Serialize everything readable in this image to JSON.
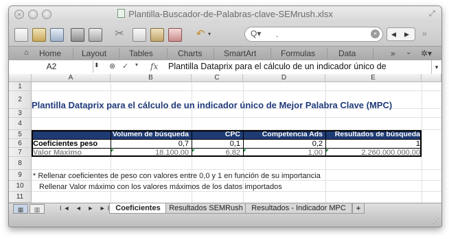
{
  "window": {
    "title": "Plantilla-Buscador-de-Palabras-clave-SEMrush.xlsx"
  },
  "toolbar": {
    "icons": [
      "new-icon",
      "templates-icon",
      "open-icon",
      "save-icon",
      "print-icon",
      "cut-icon",
      "copy-icon",
      "paste-icon",
      "format-painter-icon",
      "undo-icon"
    ],
    "search_text": "."
  },
  "ribbon": {
    "tabs": [
      "Home",
      "Layout",
      "Tables",
      "Charts",
      "SmartArt",
      "Formulas",
      "Data"
    ],
    "more": "»"
  },
  "formula_bar": {
    "cell_ref": "A2",
    "fx": "fx",
    "content": "Plantilla Dataprix para el cálculo de un indicador único de"
  },
  "grid": {
    "columns": [
      "A",
      "B",
      "C",
      "D",
      "E"
    ],
    "rows": [
      "1",
      "2",
      "3",
      "4",
      "5",
      "6",
      "7",
      "8",
      "9",
      "10",
      "11"
    ],
    "title": "Plantilla Dataprix para el cálculo de un indicador único de Mejor Palabra Clave (MPC)",
    "table": {
      "headers": [
        "Volumen de búsqueda",
        "CPC",
        "Competencia Ads",
        "Resultados de búsqueda"
      ],
      "rows": [
        {
          "label": "Coeficientes peso",
          "values": [
            "0,7",
            "0,1",
            "0,2",
            "1"
          ]
        },
        {
          "label": "Valor Maximo",
          "values": [
            "18.100,00",
            "6,82",
            "1,00",
            "2.260.000.000,00"
          ]
        }
      ]
    },
    "notes": [
      "* Rellenar coeficientes de peso con valores entre 0,0 y 1 en función de su importancia",
      "Rellenar Valor máximo con los valores máximos de los datos importados"
    ]
  },
  "sheets": {
    "nav": "I◄ ◄ ► ►I",
    "tabs": [
      "Coeficientes",
      "Resultados SEMRush",
      "Resultados - Indicador MPC"
    ],
    "active": "Coeficientes",
    "add": "+"
  },
  "colors": {
    "header_fill": "#1f3b73",
    "title_text": "#1f3a7a",
    "ribbon": "#b3b3b3"
  }
}
